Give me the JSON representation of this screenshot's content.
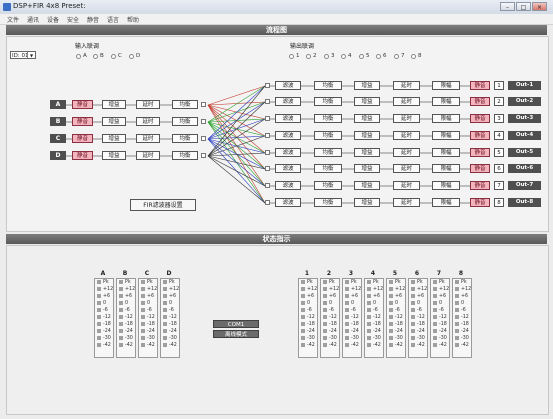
{
  "window": {
    "title": "DSP+FIR  4x8  Preset:"
  },
  "menu": [
    "文件",
    "通讯",
    "设备",
    "安全",
    "静音",
    "语言",
    "帮助"
  ],
  "headers": {
    "flow": "流程图",
    "status": "状态指示"
  },
  "device_select": {
    "value": "ID: 01"
  },
  "input_link": {
    "label": "输入联调",
    "options": [
      "A",
      "B",
      "C",
      "D"
    ]
  },
  "output_link": {
    "label": "输出联调",
    "options": [
      "1",
      "2",
      "3",
      "4",
      "5",
      "6",
      "7",
      "8"
    ]
  },
  "input_chain": {
    "mute": "静音",
    "gain": "增益",
    "delay": "延时",
    "eq": "均衡"
  },
  "inputs": [
    "A",
    "B",
    "C",
    "D"
  ],
  "output_chain": {
    "filter": "滤波",
    "eq": "均衡",
    "gain": "增益",
    "delay": "延时",
    "limit": "限幅",
    "mute": "静音"
  },
  "outputs": [
    {
      "num": "1",
      "label": "Out-1"
    },
    {
      "num": "2",
      "label": "Out-2"
    },
    {
      "num": "3",
      "label": "Out-3"
    },
    {
      "num": "4",
      "label": "Out-4"
    },
    {
      "num": "5",
      "label": "Out-5"
    },
    {
      "num": "6",
      "label": "Out-6"
    },
    {
      "num": "7",
      "label": "Out-7"
    },
    {
      "num": "8",
      "label": "Out-8"
    }
  ],
  "fir_button": "FIR滤波器设置",
  "status": {
    "com": "COM1",
    "mode": "离线模式",
    "input_meters": [
      "A",
      "B",
      "C",
      "D"
    ],
    "output_meters": [
      "1",
      "2",
      "3",
      "4",
      "5",
      "6",
      "7",
      "8"
    ],
    "levels": [
      "Pk",
      "+12",
      "+6",
      "0",
      "-6",
      "-12",
      "-18",
      "-24",
      "-30",
      "-42"
    ]
  },
  "colors": {
    "mute": "#f4b4be",
    "header": "#5f5f5f",
    "route_a": "#c0392b",
    "route_b": "#27a02a",
    "route_c": "#2a3fc0",
    "route_d": "#333333"
  }
}
